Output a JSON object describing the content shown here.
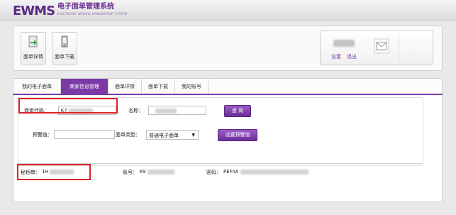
{
  "header": {
    "logo_text": "EWMS",
    "logo_title": "电子面单管理系统",
    "logo_subtitle": "ELECTRONIC WAYBILL MANAGEMENT SYSTEM"
  },
  "toolbar": {
    "buttons": [
      {
        "label": "面单详情",
        "icon": "document-arrow-icon"
      },
      {
        "label": "面单下载",
        "icon": "phone-download-icon"
      }
    ],
    "user": {
      "settings_label": "设置",
      "exit_label": "退出",
      "mail_icon": "mail-icon"
    }
  },
  "tabs": [
    {
      "label": "我的电子面单",
      "active": false
    },
    {
      "label": "商家信息管理",
      "active": true
    },
    {
      "label": "面单详情",
      "active": false
    },
    {
      "label": "面单下载",
      "active": false
    },
    {
      "label": "我的账号",
      "active": false
    }
  ],
  "form": {
    "merchant_code_label": "商家代码：",
    "merchant_code_value": "K7",
    "name_label": "名称：",
    "name_value": "",
    "query_button": "查 询",
    "warning_label": "预警值：",
    "warning_value": "",
    "waybill_type_label": "面单类型：",
    "waybill_type_value": "普通电子面单",
    "set_warning_button": "设置预警值"
  },
  "info": {
    "secret_label": "秘钥串：",
    "secret_value": "1H",
    "account_label": "账号：",
    "account_value": "K9",
    "password_label": "密码：",
    "password_value": "PEFnA"
  },
  "colors": {
    "accent": "#7b3aa8",
    "highlight": "#e0202a"
  }
}
